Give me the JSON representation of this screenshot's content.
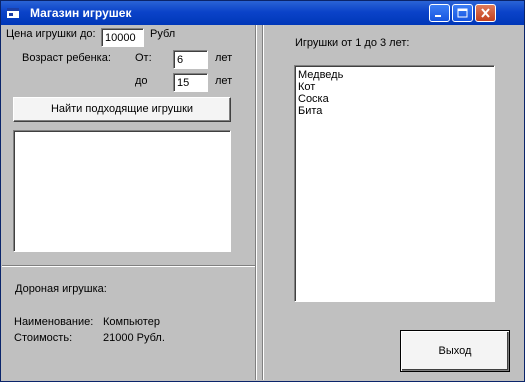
{
  "window": {
    "title": "Магазин игрушек"
  },
  "left": {
    "price_label": "Цена игрушки до:",
    "price_value": "10000",
    "price_unit": "Рубл",
    "age_label": "Возраст ребенка:",
    "from_label": "От:",
    "from_value": "6",
    "from_unit": "лет",
    "to_label": "до",
    "to_value": "15",
    "to_unit": "лет",
    "find_button": "Найти подходящие игрушки",
    "results": [],
    "expensive_heading": "Дороная игрушка:",
    "name_label": "Наименование:",
    "name_value": "Компьютер",
    "cost_label": "Стоимость:",
    "cost_value": "21000 Рубл."
  },
  "right": {
    "heading": "Игрушки от 1 до 3 лет:",
    "toys": [
      "Медведь",
      "Кот",
      "Соска",
      "Бита"
    ],
    "exit_button": "Выход"
  }
}
